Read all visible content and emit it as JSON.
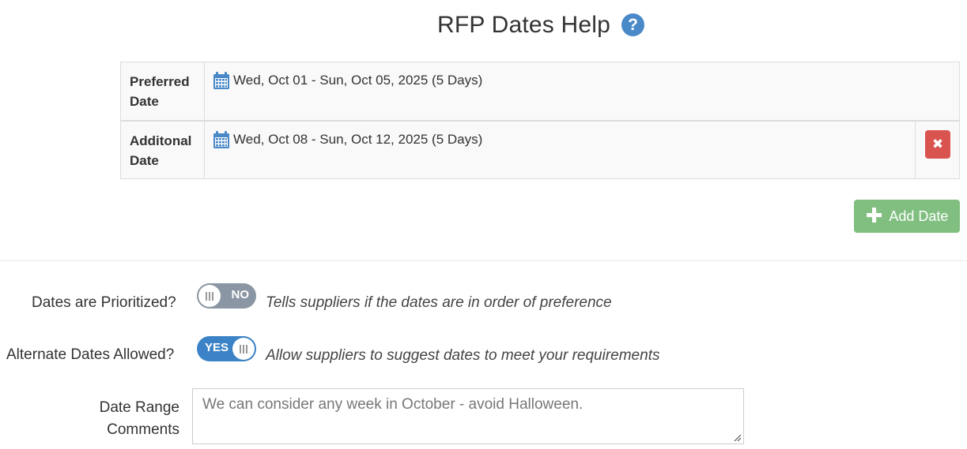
{
  "header": {
    "title": "RFP Dates Help",
    "help_icon": "question-circle-icon",
    "help_glyph": "?"
  },
  "dates": [
    {
      "label": "Preferred Date",
      "range": "Wed, Oct 01 - Sun, Oct 05, 2025 (5 Days)",
      "deletable": false
    },
    {
      "label": "Additonal Date",
      "range": "Wed, Oct 08 - Sun, Oct 12, 2025 (5 Days)",
      "deletable": true
    }
  ],
  "delete_icon": "close-icon",
  "delete_glyph": "✖",
  "add_button": {
    "label": "Add Date",
    "icon": "plus-icon",
    "glyph": "✚"
  },
  "options": {
    "prioritized": {
      "label": "Dates are Prioritized?",
      "toggle_text": "NO",
      "state": "off",
      "hint": "Tells suppliers if the dates are in order of preference"
    },
    "alternate": {
      "label": "Alternate Dates Allowed?",
      "toggle_text": "YES",
      "state": "on",
      "hint": "Allow suppliers to suggest dates to meet your requirements"
    }
  },
  "comments": {
    "label": "Date Range Comments",
    "value": "We can consider any week in October - avoid Halloween."
  },
  "colors": {
    "primary": "#3b82c6",
    "help": "#4a89c8",
    "danger": "#d9534f",
    "success": "#80bf80",
    "toggle_off": "#8a96a3"
  }
}
